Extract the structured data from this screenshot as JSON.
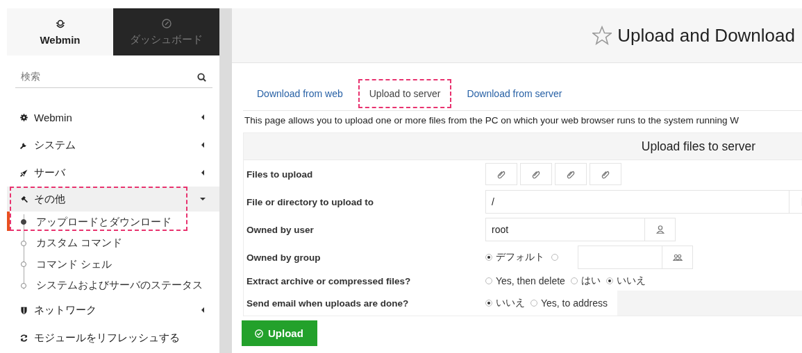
{
  "sidebar": {
    "tabs": [
      {
        "label": "Webmin",
        "selected": true
      },
      {
        "label": "ダッシュボード",
        "selected": false
      }
    ],
    "search": {
      "placeholder": "検索"
    },
    "menu": [
      {
        "label": "Webmin",
        "expanded": false
      },
      {
        "label": "システム",
        "expanded": false
      },
      {
        "label": "サーバ",
        "expanded": false
      },
      {
        "label": "その他",
        "expanded": true,
        "highlighted": true,
        "children": [
          {
            "label": "アップロードとダウンロード",
            "selected": true,
            "highlighted": true
          },
          {
            "label": "カスタム コマンド",
            "selected": false
          },
          {
            "label": "コマンド シェル",
            "selected": false
          },
          {
            "label": "システムおよびサーバのステータス",
            "selected": false
          }
        ]
      },
      {
        "label": "ネットワーク",
        "expanded": false
      },
      {
        "label": "モジュールをリフレッシュする",
        "kind": "action"
      }
    ]
  },
  "page": {
    "title": "Upload and Download",
    "tabs": [
      {
        "label": "Download from web",
        "selected": false
      },
      {
        "label": "Upload to server",
        "selected": true,
        "highlighted": true
      },
      {
        "label": "Download from server",
        "selected": false
      }
    ],
    "description": "This page allows you to upload one or more files from the PC on which your web browser runs to the system running W",
    "form": {
      "title": "Upload files to server",
      "rows": [
        {
          "label": "Files to upload",
          "kind": "files"
        },
        {
          "label": "File or directory to upload to",
          "kind": "path",
          "value": "/"
        },
        {
          "label": "Owned by user",
          "kind": "user",
          "value": "root"
        },
        {
          "label": "Owned by group",
          "kind": "group",
          "options": [
            {
              "label": "デフォルト",
              "selected": true
            }
          ],
          "other": {
            "selected": false
          }
        },
        {
          "label": "Extract archive or compressed files?",
          "kind": "radios",
          "options": [
            {
              "label": "Yes, then delete",
              "selected": false
            },
            {
              "label": "はい",
              "selected": false
            },
            {
              "label": "いいえ",
              "selected": true
            }
          ]
        },
        {
          "label": "Send email when uploads are done?",
          "kind": "email",
          "options": [
            {
              "label": "いいえ",
              "selected": true
            },
            {
              "label": "Yes, to address",
              "selected": false
            }
          ]
        }
      ]
    },
    "submit": {
      "label": "Upload"
    }
  }
}
